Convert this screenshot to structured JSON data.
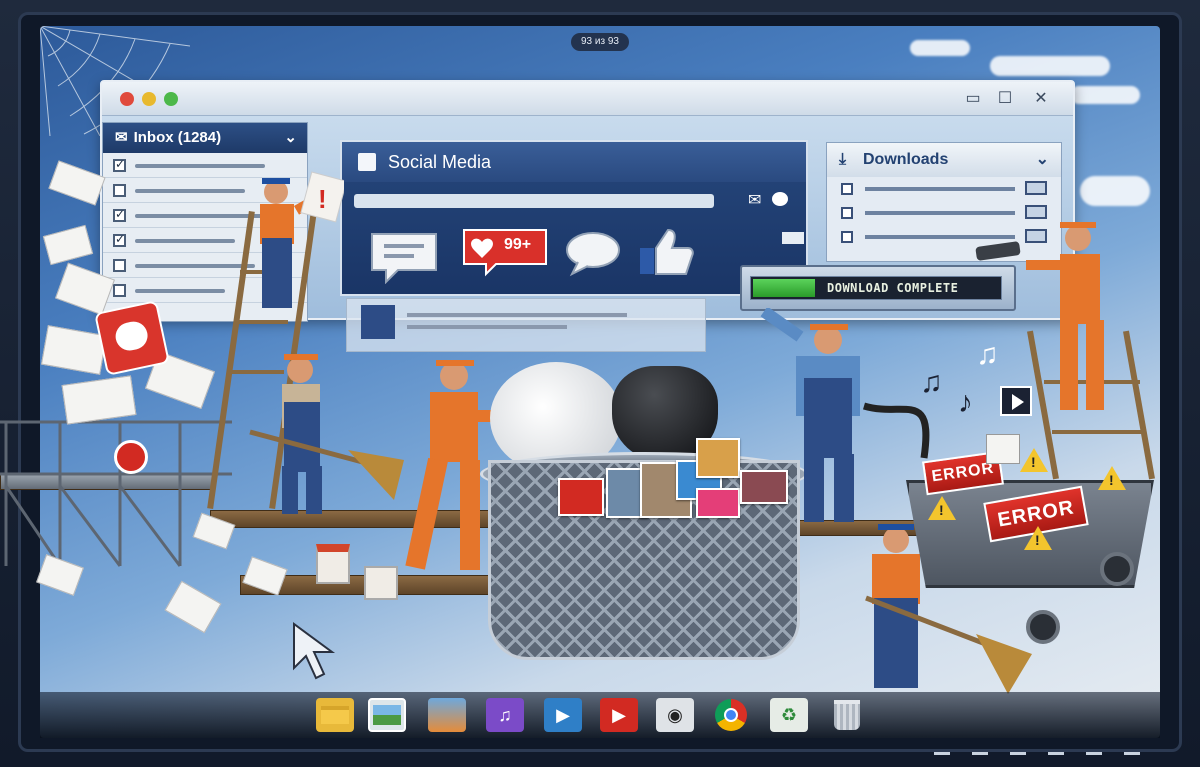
{
  "viewer": {
    "page_counter": "93 из 93"
  },
  "inbox": {
    "title": "Inbox (1284)",
    "rows": [
      {
        "checked": true
      },
      {
        "checked": false
      },
      {
        "checked": true
      },
      {
        "checked": true
      },
      {
        "checked": false
      },
      {
        "checked": false
      }
    ]
  },
  "social": {
    "title": "Social Media",
    "notification_count": "99+"
  },
  "downloads": {
    "title": "Downloads",
    "rows": 3,
    "status": "DOWNLOAD COMPLETE",
    "progress_fraction": 0.25
  },
  "errors": {
    "labels": [
      "ERROR",
      "ERROR"
    ]
  },
  "dock": {
    "icons": [
      "folder-icon",
      "photos-icon",
      "image-viewer-icon",
      "music-icon",
      "video-player-icon",
      "youtube-icon",
      "camera-icon",
      "chrome-icon",
      "recycle-icon",
      "trash-icon"
    ]
  },
  "colors": {
    "accent_orange": "#e5752b",
    "window_blue": "#2a4a80",
    "error_red": "#d22a22",
    "success_green": "#3cb43c"
  }
}
